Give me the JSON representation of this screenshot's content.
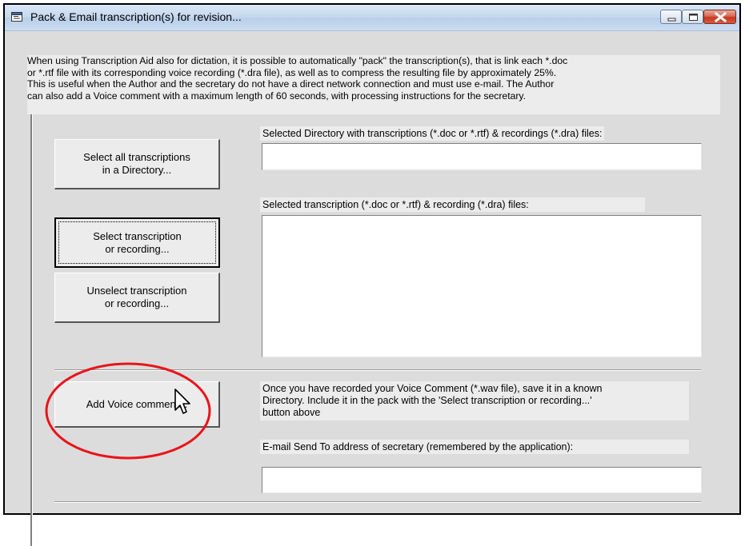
{
  "window": {
    "title": "Pack & Email transcription(s) for revision...",
    "controls": {
      "minimize": "minimize-icon",
      "maximize": "maximize-icon",
      "close": "close-icon"
    }
  },
  "intro": {
    "lines": [
      "When using Transcription Aid also for dictation, it is possible to automatically \"pack\" the transcription(s), that is link each *.doc",
      "or *.rtf file with its corresponding voice recording (*.dra file), as well as to compress the resulting file by approximately 25%.",
      "This is useful when the Author and the secretary do not have a direct network connection and must use e-mail. The Author",
      "can also add a Voice comment with a maximum length of 60 seconds, with processing instructions for the secretary."
    ]
  },
  "directory": {
    "label": "Selected Directory with transcriptions (*.doc or *.rtf) & recordings (*.dra) files:",
    "value": ""
  },
  "buttons": {
    "select_all": [
      "Select all transcriptions",
      "in a Directory..."
    ],
    "select_one": [
      "Select transcription",
      "or recording..."
    ],
    "unselect": [
      "Unselect transcription",
      "or recording..."
    ],
    "add_voice": "Add Voice comment..."
  },
  "files": {
    "label": "Selected transcription (*.doc or *.rtf) & recording (*.dra) files:",
    "items": []
  },
  "voice_note": {
    "lines": [
      "Once you have recorded your Voice Comment (*.wav file), save it in a known",
      "Directory. Include it in the pack with the 'Select transcription or recording...'",
      "button above"
    ]
  },
  "email": {
    "label": "E-mail Send To address of secretary (remembered by the application):",
    "value": ""
  },
  "annotation": {
    "highlight_color": "#e8141a"
  },
  "pointer": "mouse-pointer-icon"
}
